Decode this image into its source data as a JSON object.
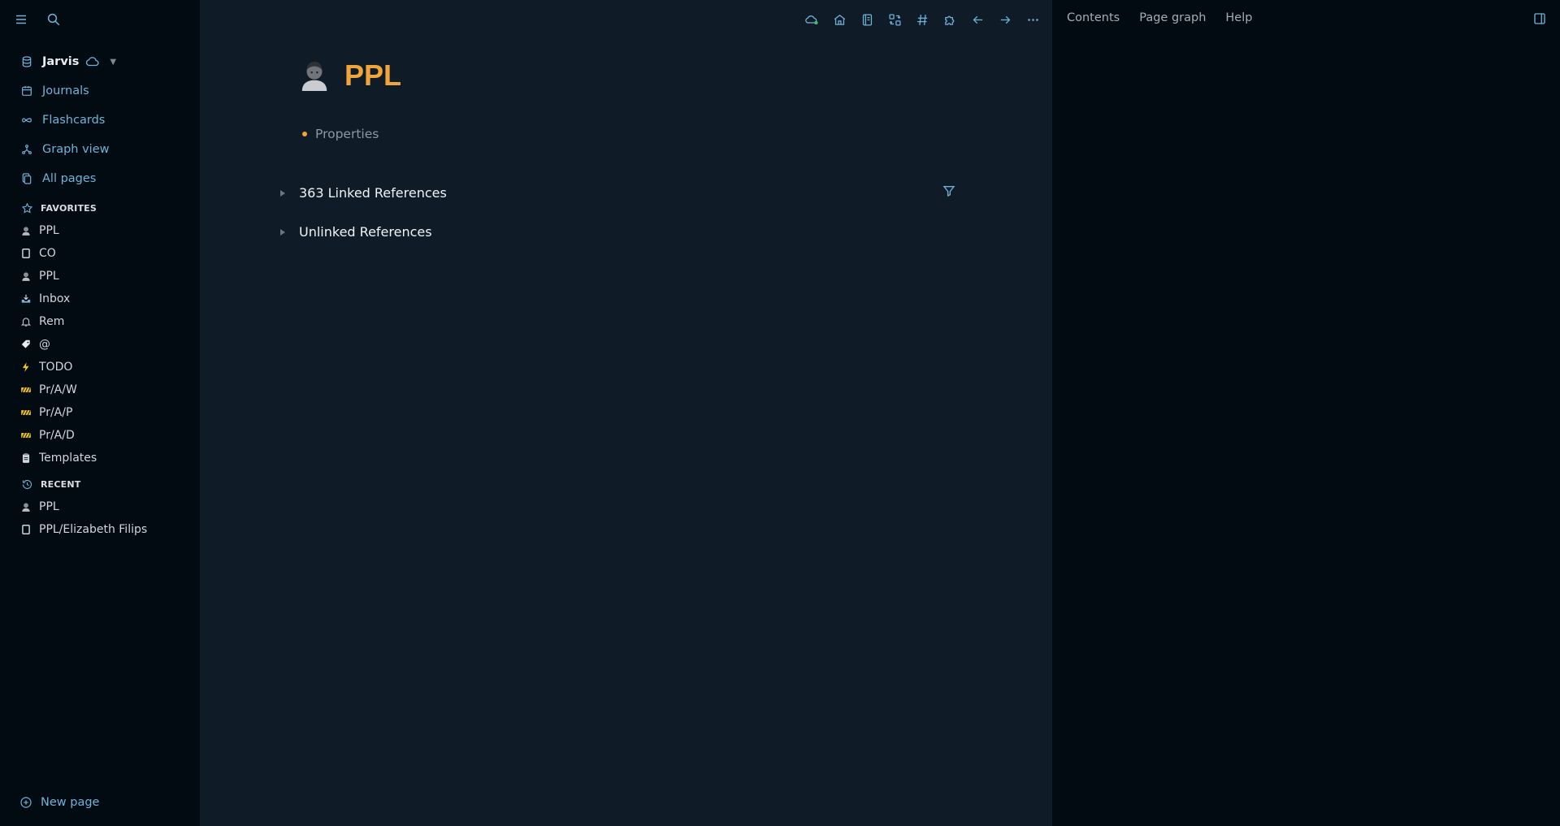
{
  "sidebar": {
    "graph": {
      "name": "Jarvis"
    },
    "nav": [
      {
        "label": "Journals",
        "icon": "calendar-icon"
      },
      {
        "label": "Flashcards",
        "icon": "infinity-icon"
      },
      {
        "label": "Graph view",
        "icon": "hierarchy-icon"
      },
      {
        "label": "All pages",
        "icon": "files-icon"
      }
    ],
    "favorites_title": "FAVORITES",
    "favorites": [
      {
        "label": "PPL",
        "icon": "person-icon"
      },
      {
        "label": "CO",
        "icon": "notebook-icon"
      },
      {
        "label": "PPL",
        "icon": "person-icon"
      },
      {
        "label": "Inbox",
        "icon": "inbox-tray-icon"
      },
      {
        "label": "Rem",
        "icon": "bell-icon"
      },
      {
        "label": "@",
        "icon": "label-icon"
      },
      {
        "label": "TODO",
        "icon": "lightning-icon"
      },
      {
        "label": "Pr/A/W",
        "icon": "barrier-icon"
      },
      {
        "label": "Pr/A/P",
        "icon": "barrier-icon"
      },
      {
        "label": "Pr/A/D",
        "icon": "barrier-icon"
      },
      {
        "label": "Templates",
        "icon": "clipboard-icon"
      }
    ],
    "recent_title": "RECENT",
    "recent": [
      {
        "label": "PPL",
        "icon": "person-icon"
      },
      {
        "label": "PPL/Elizabeth Filips",
        "icon": "notebook-icon"
      }
    ],
    "new_page": "New page"
  },
  "page": {
    "title": "PPL",
    "property_label": "Properties",
    "linked_refs": "363 Linked References",
    "unlinked_refs": "Unlinked References"
  },
  "right_panel": {
    "tabs": [
      "Contents",
      "Page graph",
      "Help"
    ]
  },
  "colors": {
    "accent": "#6fb3d8",
    "title": "#f0a53a",
    "sync_dot": "#3ec46d"
  }
}
